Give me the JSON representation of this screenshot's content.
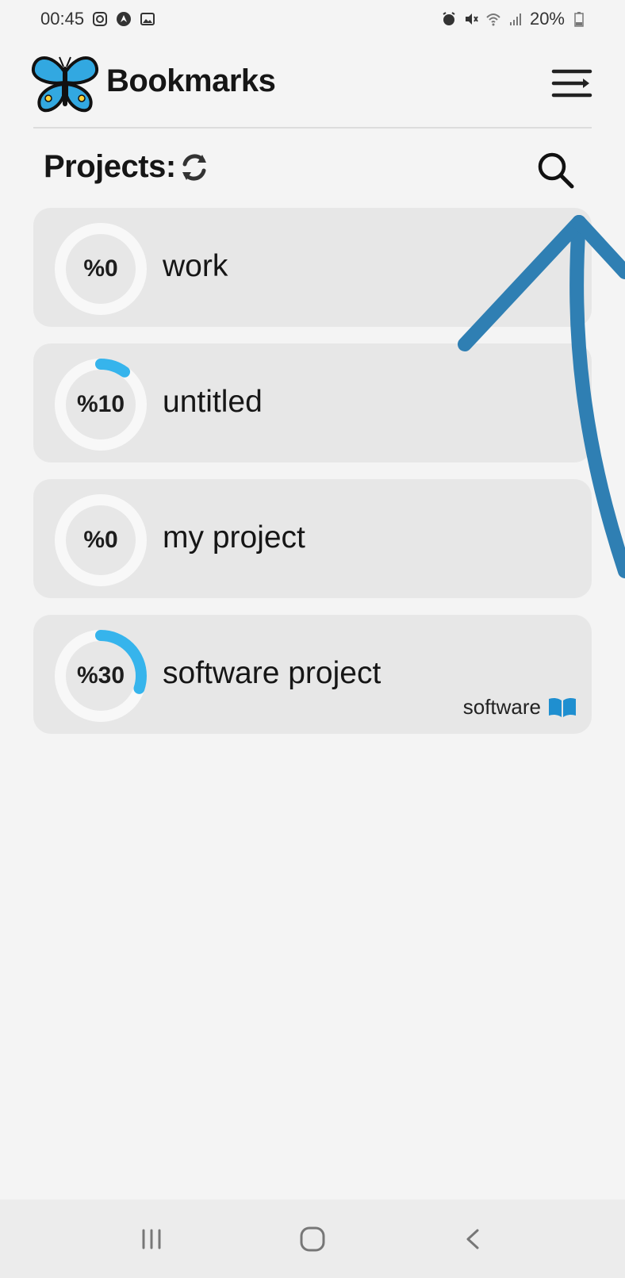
{
  "status_bar": {
    "time": "00:45",
    "battery": "20%",
    "left_icons": [
      "instagram-icon",
      "navigation-app-icon",
      "gallery-icon"
    ],
    "right_icons": [
      "alarm-icon",
      "mute-icon",
      "wifi-icon",
      "signal-icon",
      "battery-icon"
    ]
  },
  "header": {
    "title": "Bookmarks",
    "logo_icon": "butterfly-logo-icon",
    "menu_icon": "menu-icon"
  },
  "section": {
    "title": "Projects:",
    "refresh_icon": "refresh-icon",
    "search_icon": "search-icon"
  },
  "projects": [
    {
      "label": "%0",
      "progress": 0,
      "name": "work"
    },
    {
      "label": "%10",
      "progress": 10,
      "name": "untitled"
    },
    {
      "label": "%0",
      "progress": 0,
      "name": "my project"
    },
    {
      "label": "%30",
      "progress": 30,
      "name": "software project",
      "tag": "software",
      "tag_icon": "book-icon"
    }
  ],
  "annotation": {
    "arrow_icon": "annotation-arrow-icon",
    "color": "#2f7fb3"
  },
  "nav_bar": {
    "items": [
      "recent-apps-icon",
      "home-icon",
      "back-icon"
    ]
  },
  "colors": {
    "progress": "#36b4ec",
    "ring_track": "#f8f8f8",
    "card_bg": "#e7e7e7",
    "logo_blue": "#32a8e1"
  }
}
